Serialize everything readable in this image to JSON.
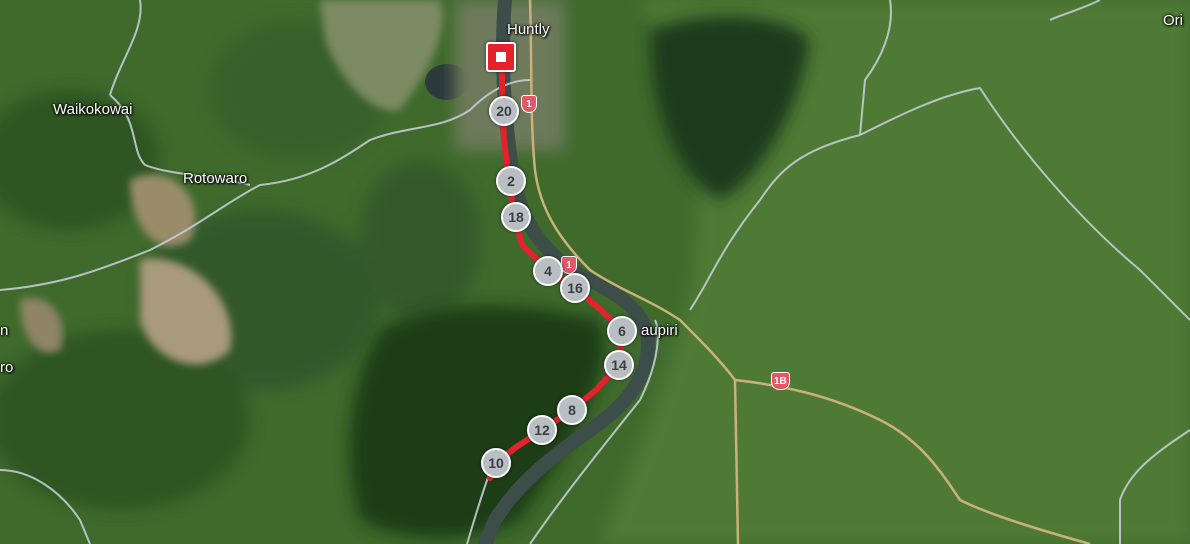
{
  "map": {
    "places": [
      {
        "id": "huntly",
        "label": "Huntly"
      },
      {
        "id": "waikokowai",
        "label": "Waikokowai"
      },
      {
        "id": "rotowaro",
        "label": "Rotowaro"
      },
      {
        "id": "taupiri",
        "label": "aupiri"
      },
      {
        "id": "ori",
        "label": "Ori"
      },
      {
        "id": "edge-n",
        "label": "n"
      },
      {
        "id": "edge-ro",
        "label": "ro"
      }
    ],
    "km_markers": [
      "20",
      "2",
      "18",
      "4",
      "16",
      "6",
      "14",
      "8",
      "12",
      "10"
    ],
    "highway_shields": [
      "1",
      "1",
      "1B"
    ],
    "colors": {
      "route": "#e3222c",
      "river": "#3d4e4a",
      "road": "#c4ccd3",
      "highway": "#c9b27a",
      "marker": "#b9bec3"
    }
  }
}
